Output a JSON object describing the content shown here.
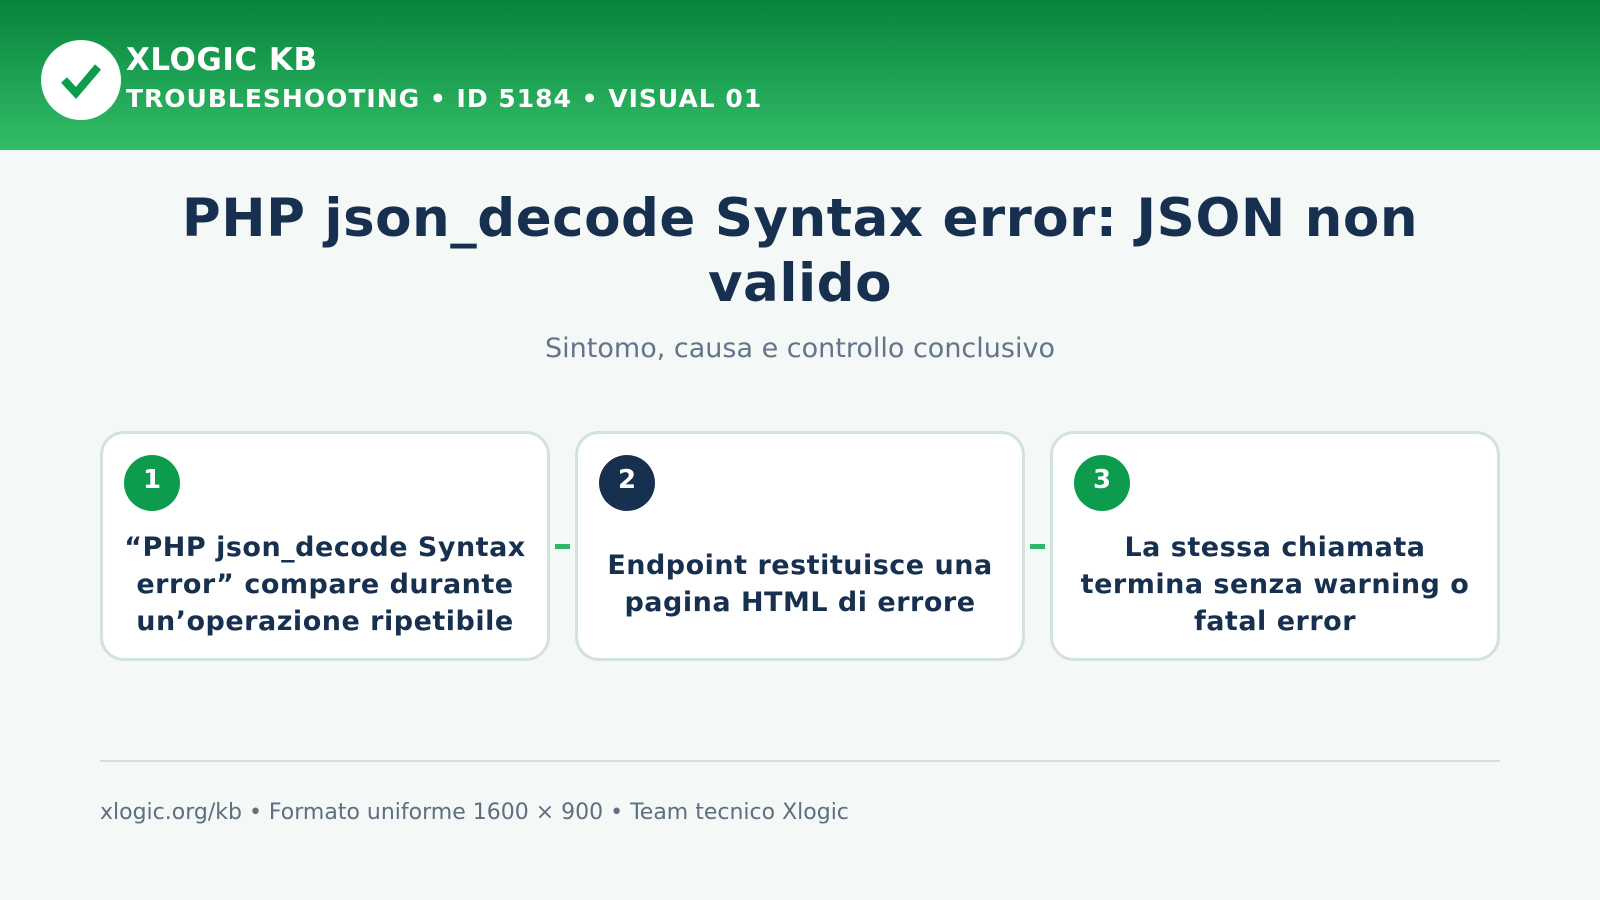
{
  "header": {
    "brand": "XLOGIC KB",
    "subline": "TROUBLESHOOTING • ID 5184 • VISUAL 01",
    "logo_icon": "check-icon",
    "gradient_top": "#06843c",
    "gradient_bottom": "#33bd68"
  },
  "main": {
    "title": "PHP json_decode Syntax error: JSON non valido",
    "subtitle": "Sintomo, causa e controllo conclusivo"
  },
  "steps": [
    {
      "number": "1",
      "text": "“PHP json_decode Syntax error” compare durante un’operazione ripetibile",
      "badge_color": "#0d9b4d"
    },
    {
      "number": "2",
      "text": "Endpoint restituisce una pagina HTML di errore",
      "badge_color": "#17304f"
    },
    {
      "number": "3",
      "text": "La stessa chiamata termina senza warning o fatal error",
      "badge_color": "#0d9b4d"
    }
  ],
  "footer": {
    "text": "xlogic.org/kb • Formato uniforme 1600 × 900 • Team tecnico Xlogic"
  }
}
